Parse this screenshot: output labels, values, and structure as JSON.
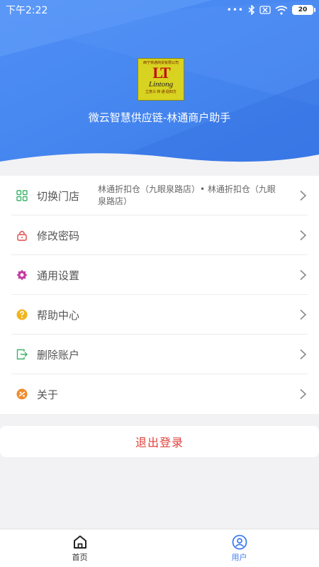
{
  "status_bar": {
    "time": "下午2:22",
    "dots": "•••",
    "battery": "20"
  },
  "app": {
    "name": "微云智慧供应链-林通商户助手"
  },
  "logo": {
    "top_text": "西宁林通商贸有限公司",
    "mark": "LT",
    "name": "Lintong",
    "bottom_text": "立意义 林 通 促四方"
  },
  "menu": {
    "items": [
      {
        "label": "切换门店",
        "value": "林通折扣仓（九眼泉路店）• 林通折扣仓（九眼泉路店）",
        "icon": "grid-icon",
        "color": "#3db36a"
      },
      {
        "label": "修改密码",
        "icon": "lock-icon",
        "color": "#e24b4b"
      },
      {
        "label": "通用设置",
        "icon": "gear-icon",
        "color": "#c63ba0"
      },
      {
        "label": "帮助中心",
        "icon": "help-icon",
        "color": "#f1b41b"
      },
      {
        "label": "删除账户",
        "icon": "exit-icon",
        "color": "#3db36a"
      },
      {
        "label": "关于",
        "icon": "info-icon",
        "color": "#f08a2c"
      }
    ]
  },
  "logout": {
    "label": "退出登录",
    "color": "#e0413b"
  },
  "bottom_nav": {
    "items": [
      {
        "label": "首页",
        "icon": "home-icon",
        "active": false
      },
      {
        "label": "用户",
        "icon": "user-icon",
        "active": true
      }
    ]
  },
  "colors": {
    "accent": "#3d7cf0",
    "header": "#4787f0"
  }
}
